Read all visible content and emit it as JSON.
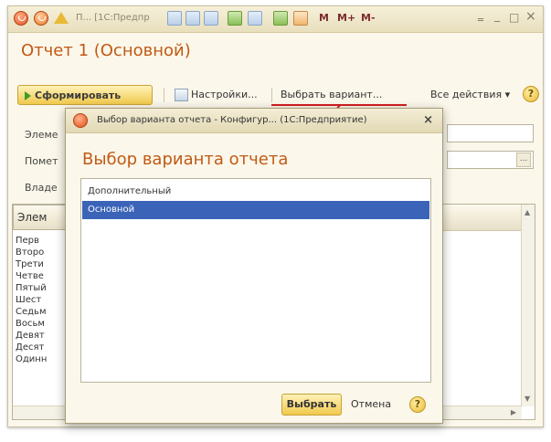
{
  "titlebar": {
    "text": "П... [1С:Предпр",
    "m_label": "M",
    "mplus_label": "M+",
    "mminus_label": "M-",
    "minimize": "‗",
    "restore": "_",
    "maximize": "□",
    "close": "×"
  },
  "report": {
    "title": "Отчет 1 (Основной)"
  },
  "toolbar": {
    "generate_label": "Сформировать",
    "settings_label": "Настройки...",
    "select_variant_label": "Выбрать вариант...",
    "all_actions_label": "Все действия ▾",
    "help": "?"
  },
  "form": {
    "field1_label": "Элеме",
    "field2_label": "Помет",
    "field3_label": "Владе",
    "field2_button": "..."
  },
  "table": {
    "header": "Элем",
    "rows": [
      "Перв",
      "Второ",
      "Трети",
      "Четве",
      "Пятый",
      "Шест",
      "Седьм",
      "Восьм",
      "Девят",
      "Десят",
      "Одинн"
    ]
  },
  "dialog": {
    "window_title": "Выбор варианта отчета - Конфигур... (1С:Предприятие)",
    "close": "×",
    "heading": "Выбор варианта отчета",
    "variants": [
      "Дополнительный",
      "Основной"
    ],
    "selected_index": 1,
    "choose_label": "Выбрать",
    "cancel_label": "Отмена",
    "help": "?"
  },
  "colors": {
    "accent_title": "#c05a16",
    "selection": "#3b63b8",
    "button_yellow": "#f0c94d",
    "annotation_red": "#d21f1f"
  }
}
